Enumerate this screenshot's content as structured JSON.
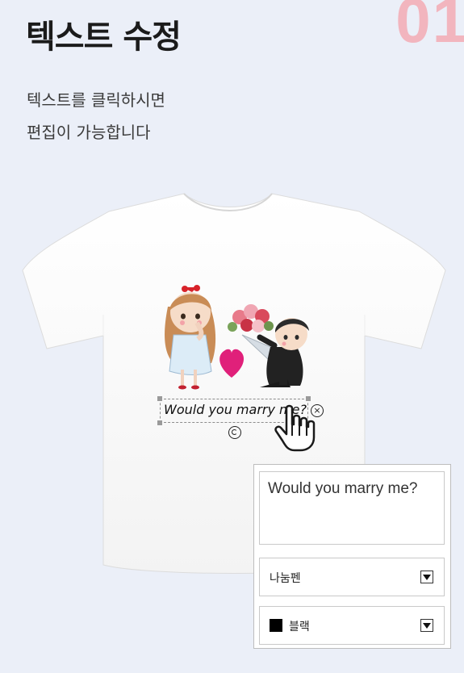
{
  "header": {
    "step_number": "01",
    "title": "텍스트 수정",
    "description_line1": "텍스트를 클릭하시면",
    "description_line2": "편집이 가능합니다"
  },
  "design": {
    "text": "Would you marry me?"
  },
  "editor": {
    "text_value": "Would you marry me?",
    "font_value": "나눔펜",
    "color_value": "블랙",
    "color_swatch": "#000000"
  },
  "colors": {
    "background": "#ebeff8",
    "step_number": "#f2b5be",
    "heart": "#e0207a"
  },
  "icons": [
    "close-icon",
    "rotate-icon",
    "hand-cursor-icon",
    "chevron-down-icon",
    "heart-icon"
  ]
}
